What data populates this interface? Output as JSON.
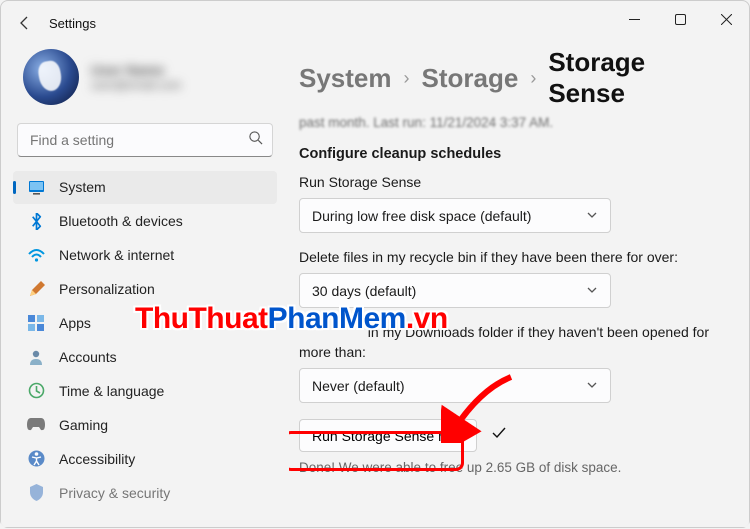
{
  "window": {
    "title": "Settings"
  },
  "profile": {
    "name": "User Name",
    "email": "user@email.com"
  },
  "search": {
    "placeholder": "Find a setting"
  },
  "sidebar": {
    "items": [
      {
        "label": "System"
      },
      {
        "label": "Bluetooth & devices"
      },
      {
        "label": "Network & internet"
      },
      {
        "label": "Personalization"
      },
      {
        "label": "Apps"
      },
      {
        "label": "Accounts"
      },
      {
        "label": "Time & language"
      },
      {
        "label": "Gaming"
      },
      {
        "label": "Accessibility"
      },
      {
        "label": "Privacy & security"
      }
    ]
  },
  "breadcrumb": {
    "a": "System",
    "b": "Storage",
    "c": "Storage Sense"
  },
  "scroll_hint": "past month. Last run: 11/21/2024 3:37 AM.",
  "sections": {
    "configure": "Configure cleanup schedules",
    "runLabel": "Run Storage Sense",
    "runValue": "During low free disk space (default)",
    "recycleLabel": "Delete files in my recycle bin if they have been there for over:",
    "recycleValue": "30 days (default)",
    "downloadsLabel_a": "in my Downloads folder if they haven't been opened for",
    "downloadsLabel_b": "more than:",
    "downloadsValue": "Never (default)",
    "runNow": "Run Storage Sense now",
    "done": "Done! We were able to free up 2.65 GB of disk space."
  },
  "watermark": {
    "a": "ThuThuat",
    "b": "PhanMem",
    "c": ".vn"
  }
}
